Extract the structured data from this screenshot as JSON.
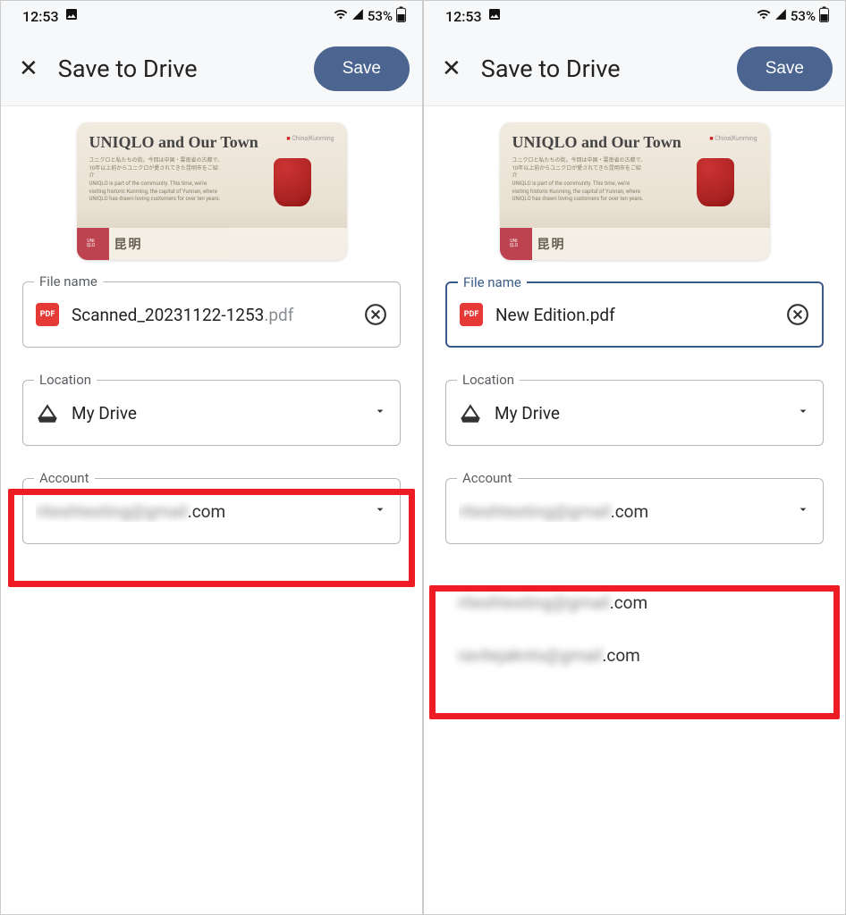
{
  "status": {
    "time": "12:53",
    "battery_pct": "53%"
  },
  "header": {
    "title": "Save to Drive",
    "save_label": "Save"
  },
  "preview": {
    "title": "UNIQLO and Our Town",
    "tag_red": "■",
    "tag_text": "China|Kunming",
    "strip_chars": "昆明",
    "uni_text": "UNI QLO"
  },
  "fields": {
    "file_label": "File name",
    "location_label": "Location",
    "account_label": "Account",
    "location_value": "My Drive",
    "pdf_icon": "PDF"
  },
  "left": {
    "file_value": "Scanned_20231122-1253",
    "file_ext": ".pdf",
    "account_blurred": "riteshtesting@gmail",
    "account_suffix": ".com"
  },
  "right": {
    "file_value": "New Edition.pdf",
    "account_blurred": "riteshtesting@gmail",
    "account_suffix": ".com",
    "options": [
      {
        "blurred": "riteshtesting@gmail",
        "suffix": ".com"
      },
      {
        "blurred": "ravitejaknts@gmail",
        "suffix": ".com"
      }
    ]
  }
}
